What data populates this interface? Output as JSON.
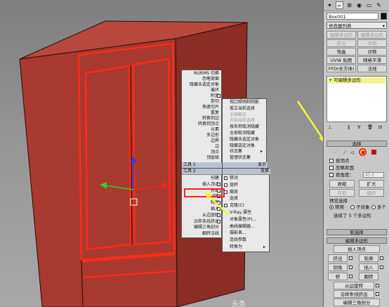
{
  "colors": {
    "model_red": "#a83a2f",
    "edge_red": "#ff2a1a",
    "highlight_yellow": "#f3f53a",
    "selected_fill": "#f1f48a"
  },
  "modifier_panel": {
    "object_name": "Box001",
    "modifier_list": "修改器列表",
    "buttons": [
      [
        "编辑多边形",
        "编辑多边形"
      ],
      [
        "挤出",
        "车削"
      ],
      [
        "弯曲",
        "对称"
      ],
      [
        "UVW 贴图",
        "网格平滑"
      ],
      [
        "FFD(长方体)",
        "法线"
      ]
    ],
    "stack_item": "可编辑多边形",
    "selection_title": "选择",
    "by_vertex": "按顶点",
    "ignore_backfacing": "忽略背面",
    "by_angle": "按角度：",
    "angle_value": "45.0",
    "shrink": "收缩",
    "grow": "扩大",
    "ring": "环形",
    "loop": "循环",
    "preview_selection": "预览选择",
    "disabled": "禁用",
    "sub_object": "子对象",
    "multi": "多个",
    "selected_count": "选择了 5 个多边形",
    "soft_selection": "软选择",
    "edit_polygons": "编辑多边形",
    "insert_vertex": "插入顶点",
    "extrude": "挤出",
    "outline": "轮廓",
    "bevel": "倒角",
    "inset": "插入",
    "bridge": "桥",
    "flip": "翻转",
    "hinge_from_edge": "从边旋转",
    "extrude_along_spline": "沿样条线挤出",
    "edit_triangulation": "编辑三角剖分"
  },
  "quad_left_top": [
    "NURMS 切换",
    "忽略背面",
    "隐藏未选定对象",
    "循环",
    "附加",
    "剪切",
    "快速切片",
    "重复",
    "转换到边",
    "转换到顶点",
    "元素",
    "多边形",
    "边界",
    "边",
    "顶点",
    "顶层级"
  ],
  "quad_left_top_header": "工具 1",
  "quad_left_bottom_header": "工具 2",
  "quad_left_bottom": [
    "创建",
    "插入顶点",
    "挤出",
    "倒角",
    "轮廓",
    "插入",
    "从边旋转",
    "沿样条线挤出",
    "编辑三角剖分",
    "翻转法线"
  ],
  "quad_right_top": [
    "视口照明和阴影",
    "孤立当前选择",
    "全部解冻",
    "冻结当前选择",
    "按名称取消隐藏",
    "全部取消隐藏",
    "隐藏未选定对象",
    "隐藏选定对象",
    "状态集",
    "管理状态集"
  ],
  "quad_right_top_header": "显示",
  "quad_right_bottom_header": "变换",
  "quad_right_bottom": [
    "移动",
    "旋转",
    "缩放",
    "选择",
    "克隆(C)",
    "V-Ray 属性",
    "对象属性(P)...",
    "曲线编辑器...",
    "摄影表...",
    "连线参数",
    "转换为"
  ],
  "watermark": "头条"
}
